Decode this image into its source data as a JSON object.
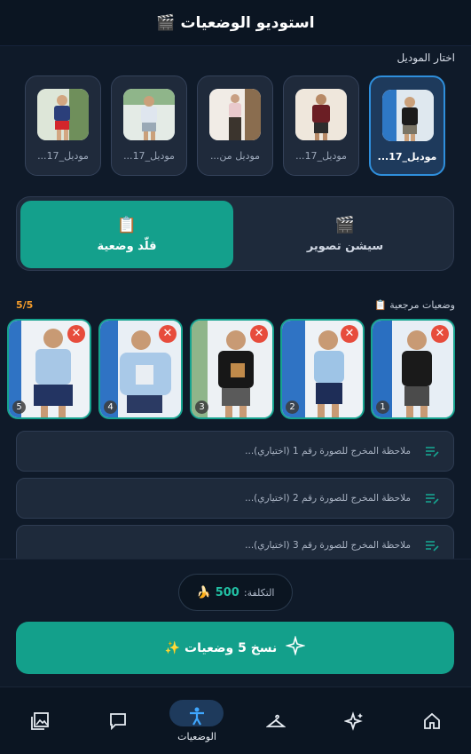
{
  "header": {
    "title": "استوديو الوضعيات 🎬"
  },
  "models_section": {
    "label": "اختار الموديل",
    "models": [
      {
        "name": "موديل_17...",
        "selected": true
      },
      {
        "name": "موديل_17..."
      },
      {
        "name": "موديل من..."
      },
      {
        "name": "موديل_17..."
      },
      {
        "name": "موديل_17..."
      }
    ]
  },
  "mode_toggle": {
    "session": {
      "icon": "🎬",
      "label": "سيشن تصوير"
    },
    "copy_pose": {
      "icon": "📋",
      "label": "قلّد وضعية"
    }
  },
  "references": {
    "title": "وضعيات مرجعية 📋",
    "count": "5/5",
    "items": [
      {
        "num": "1",
        "remove": "✕"
      },
      {
        "num": "2",
        "remove": "✕"
      },
      {
        "num": "3",
        "remove": "✕"
      },
      {
        "num": "4",
        "remove": "✕"
      },
      {
        "num": "5",
        "remove": "✕"
      }
    ]
  },
  "notes": [
    {
      "placeholder": "ملاحظة المخرج للصورة رقم 1 (اختياري)..."
    },
    {
      "placeholder": "ملاحظة المخرج للصورة رقم 2 (اختياري)..."
    },
    {
      "placeholder": "ملاحظة المخرج للصورة رقم 3 (اختياري)..."
    }
  ],
  "cost": {
    "label": "التكلفة:",
    "value": "500",
    "icon": "🍌"
  },
  "primary_action": {
    "label": "نسخ 5 وضعيات ✨",
    "icon": "sparkles-icon"
  },
  "tabbar": {
    "tabs": [
      {
        "name": "home-icon",
        "label": ""
      },
      {
        "name": "sparkles-icon",
        "label": ""
      },
      {
        "name": "hanger-icon",
        "label": ""
      },
      {
        "name": "pose-icon",
        "label": "الوضعيات",
        "active": true
      },
      {
        "name": "chat-icon",
        "label": ""
      },
      {
        "name": "gallery-icon",
        "label": ""
      }
    ]
  },
  "colors": {
    "accent_teal": "#13a08b",
    "selected_blue": "#2f8fdc",
    "count_orange": "#f39c2b",
    "remove_red": "#e74c3c"
  }
}
